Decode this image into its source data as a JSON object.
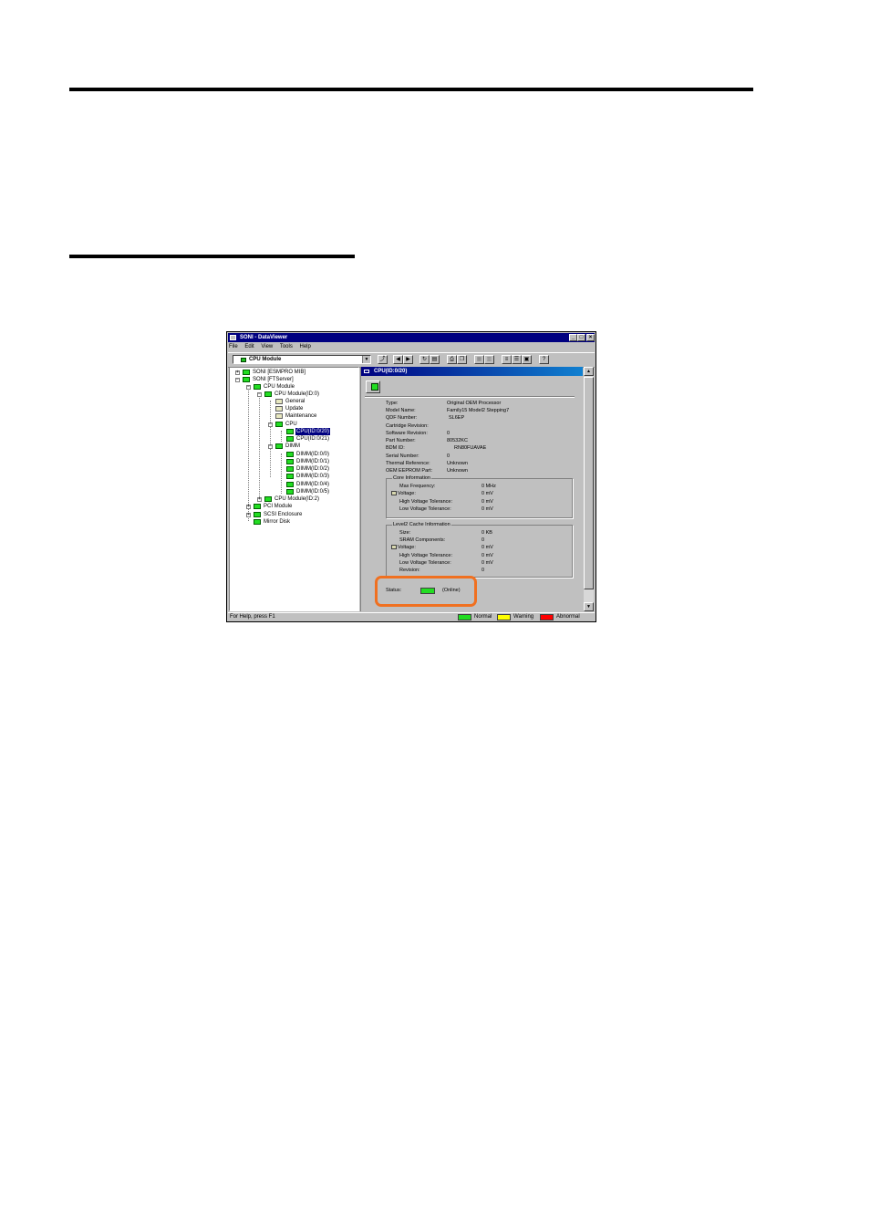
{
  "window": {
    "title": "SONI - DataViewer",
    "controls": {
      "minimize": "_",
      "maximize": "□",
      "close": "×"
    }
  },
  "menu": [
    "File",
    "Edit",
    "View",
    "Tools",
    "Help"
  ],
  "combo": {
    "value": "CPU Module"
  },
  "tree": {
    "nodes": [
      {
        "label": "SONI [ESMPRO MIB]"
      },
      {
        "label": "SONI [FTServer]"
      },
      {
        "label": "CPU Module"
      },
      {
        "label": "CPU Module(ID:0)"
      },
      {
        "label": "General"
      },
      {
        "label": "Update"
      },
      {
        "label": "Maintenance"
      },
      {
        "label": "CPU"
      },
      {
        "label": "CPU(ID:0/20)"
      },
      {
        "label": "CPU(ID:0/21)"
      },
      {
        "label": "DIMM"
      },
      {
        "label": "DIMM(ID:0/0)"
      },
      {
        "label": "DIMM(ID:0/1)"
      },
      {
        "label": "DIMM(ID:0/2)"
      },
      {
        "label": "DIMM(ID:0/3)"
      },
      {
        "label": "DIMM(ID:0/4)"
      },
      {
        "label": "DIMM(ID:0/5)"
      },
      {
        "label": "CPU Module(ID:2)"
      },
      {
        "label": "PCI Module"
      },
      {
        "label": "SCSI Enclosure"
      },
      {
        "label": "Mirror Disk"
      }
    ]
  },
  "panel": {
    "title": "CPU(ID:0/20)",
    "props": [
      {
        "label": "Type:",
        "value": "Original OEM Processor"
      },
      {
        "label": "Model Name:",
        "value": "Family15 Model2 Stepping7"
      },
      {
        "label": "QDF Number:",
        "value": "SL6EP"
      },
      {
        "label": "Cartridge Revision:",
        "value": ""
      },
      {
        "label": "Software Revision:",
        "value": "0"
      },
      {
        "label": "Part Number:",
        "value": "80532KC"
      },
      {
        "label": "BDM ID:",
        "value": "RN80FUAVAE"
      },
      {
        "label": "Serial Number:",
        "value": "0"
      },
      {
        "label": "Thermal Reference:",
        "value": "Unknown"
      },
      {
        "label": "OEM EEPROM Part:",
        "value": "Unknown"
      }
    ],
    "core": {
      "title": "Core Information",
      "rows": [
        {
          "label": "Max Frequency:",
          "value": "0 MHz"
        },
        {
          "label": "Voltage:",
          "value": "0 mV"
        },
        {
          "label": "High Voltage Tolerance:",
          "value": "0 mV"
        },
        {
          "label": "Low Voltage Tolerance:",
          "value": "0 mV"
        }
      ]
    },
    "l2": {
      "title": "Level2 Cache Information",
      "rows": [
        {
          "label": "Size:",
          "value": "0 KB"
        },
        {
          "label": "SRAM Components:",
          "value": "0"
        },
        {
          "label": "Voltage:",
          "value": "0 mV"
        },
        {
          "label": "High Voltage Tolerance:",
          "value": "0 mV"
        },
        {
          "label": "Low Voltage Tolerance:",
          "value": "0 mV"
        },
        {
          "label": "Revision:",
          "value": "0"
        }
      ]
    },
    "status": {
      "label": "Status:",
      "value": "(Online)",
      "color": "#22dd22"
    },
    "highlight_color": "#f07020"
  },
  "statusbar": {
    "help": "For Help, press F1",
    "legend": [
      {
        "label": "Normal",
        "color": "#22dd22"
      },
      {
        "label": "Warning",
        "color": "#ffff00"
      },
      {
        "label": "Abnormal",
        "color": "#ff0000"
      }
    ]
  }
}
